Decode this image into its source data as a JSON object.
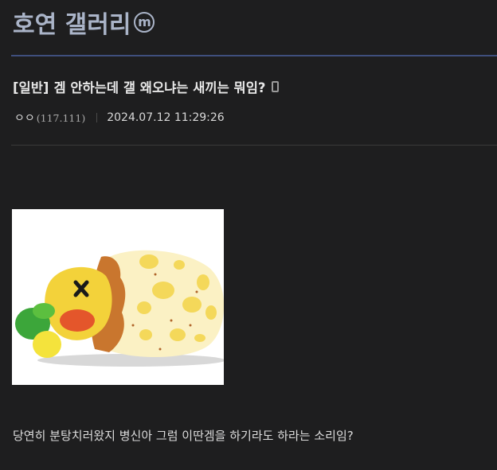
{
  "header": {
    "gallery_title": "호연 갤러리",
    "badge": "m"
  },
  "post": {
    "category": "[일반]",
    "title": "겜 안하는데 갤 왜오냐는 새끼는 뭐임?",
    "author": "ㅇㅇ",
    "ip": "(117.111)",
    "datetime": "2024.07.12 11:29:26",
    "body": "당연히 분탕치러왔지 병신아 그럼 이딴겜을 하기라도 하라는 소리임?"
  },
  "icons": {
    "mobile": "mobile-phone-icon",
    "minor_gallery": "minor-gallery-badge-icon"
  },
  "colors": {
    "background": "#1e1e1f",
    "title_accent": "#aab4c8",
    "header_rule": "#3f4f7d"
  }
}
